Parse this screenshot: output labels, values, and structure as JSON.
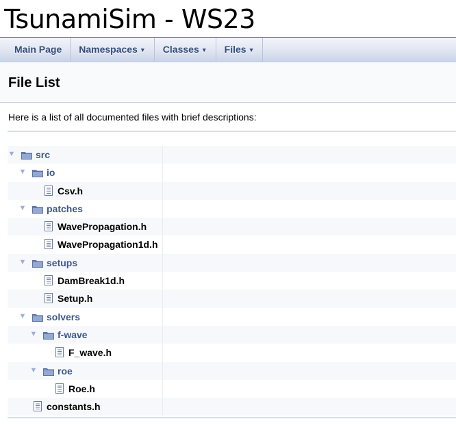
{
  "project": {
    "name": "TsunamiSim - WS23"
  },
  "nav": {
    "items": [
      {
        "label": "Main Page",
        "dropdown": false
      },
      {
        "label": "Namespaces",
        "dropdown": true
      },
      {
        "label": "Classes",
        "dropdown": true
      },
      {
        "label": "Files",
        "dropdown": true
      }
    ]
  },
  "page": {
    "title": "File List",
    "intro": "Here is a list of all documented files with brief descriptions:"
  },
  "tree": [
    {
      "type": "folder",
      "depth": 0,
      "expanded": true,
      "label": "src"
    },
    {
      "type": "folder",
      "depth": 1,
      "expanded": true,
      "label": "io"
    },
    {
      "type": "file",
      "depth": 2,
      "label": "Csv.h"
    },
    {
      "type": "folder",
      "depth": 1,
      "expanded": true,
      "label": "patches"
    },
    {
      "type": "file",
      "depth": 2,
      "label": "WavePropagation.h"
    },
    {
      "type": "file",
      "depth": 2,
      "label": "WavePropagation1d.h"
    },
    {
      "type": "folder",
      "depth": 1,
      "expanded": true,
      "label": "setups"
    },
    {
      "type": "file",
      "depth": 2,
      "label": "DamBreak1d.h"
    },
    {
      "type": "file",
      "depth": 2,
      "label": "Setup.h"
    },
    {
      "type": "folder",
      "depth": 1,
      "expanded": true,
      "label": "solvers"
    },
    {
      "type": "folder",
      "depth": 2,
      "expanded": true,
      "label": "f-wave"
    },
    {
      "type": "file",
      "depth": 3,
      "label": "F_wave.h"
    },
    {
      "type": "folder",
      "depth": 2,
      "expanded": true,
      "label": "roe"
    },
    {
      "type": "file",
      "depth": 3,
      "label": "Roe.h"
    },
    {
      "type": "file",
      "depth": 1,
      "label": "constants.h"
    }
  ],
  "icons": {
    "folder": "folder-icon",
    "file": "file-icon",
    "expand": "expand-arrow-icon",
    "dropdown": "caret-down-icon"
  },
  "colors": {
    "link": "#3d578c",
    "nav_text": "#364d7c",
    "folder": "#6f87b5",
    "rule": "#5373b4"
  }
}
